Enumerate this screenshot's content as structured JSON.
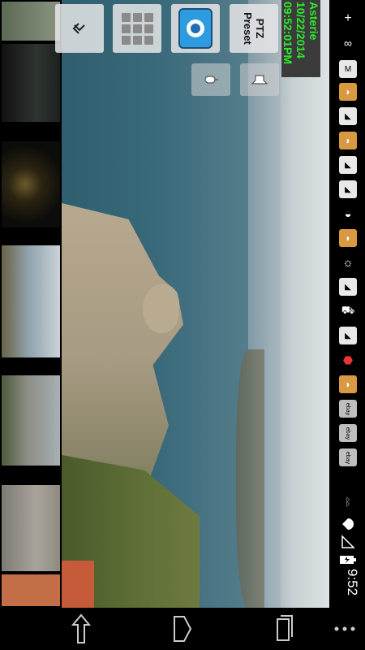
{
  "info": {
    "camera_name": "Asterie",
    "date": "10/22/2014",
    "time": "09:52:01PM",
    "text_color": "#2ee82e"
  },
  "toolbar": {
    "menu_icon": "collapse-chevron-icon",
    "grid_icon": "grid-view-icon",
    "record_icon": "record-icon",
    "ptz_line1": "PTZ",
    "ptz_line2": "Preset",
    "mic_icon": "microphone-icon",
    "speaker_icon": "speaker-icon"
  },
  "thumbnails": [
    {
      "name": "camera-thumbnail-1"
    },
    {
      "name": "camera-thumbnail-2"
    },
    {
      "name": "camera-thumbnail-3"
    },
    {
      "name": "camera-thumbnail-4"
    },
    {
      "name": "camera-thumbnail-5"
    },
    {
      "name": "camera-thumbnail-6"
    },
    {
      "name": "camera-thumbnail-7"
    }
  ],
  "statusbar": {
    "clock": "9:52",
    "icons": [
      "add-icon",
      "link-icon",
      "gmail-icon",
      "notification-icon",
      "flag-icon",
      "notification-icon",
      "flag-icon",
      "flag-icon",
      "shell-icon",
      "notification-icon",
      "sun-icon",
      "flag-icon",
      "cart-icon",
      "flag-icon",
      "usb-icon",
      "notification-icon",
      "ebay-icon",
      "ebay-icon",
      "ebay-icon",
      "bluetooth-icon",
      "wifi-icon",
      "signal-icon",
      "battery-icon"
    ],
    "ebay_label": "ebay"
  },
  "navbar": {
    "icons": [
      "back-icon",
      "home-icon",
      "recent-apps-icon",
      "menu-dots-icon"
    ]
  }
}
